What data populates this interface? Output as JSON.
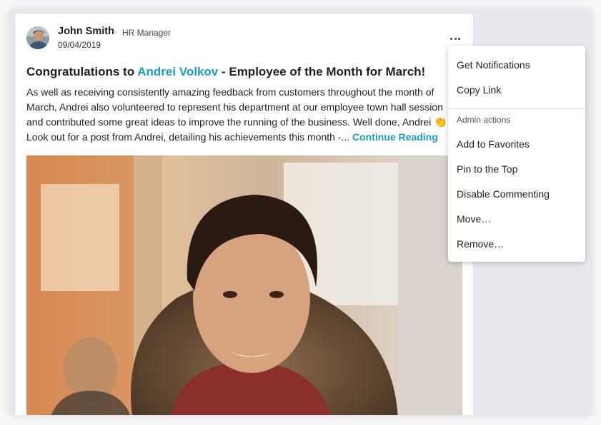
{
  "post": {
    "author": {
      "name": "John Smith",
      "separator": "·",
      "role": "HR Manager",
      "date": "09/04/2019"
    },
    "title": {
      "prefix": "Congratulations to ",
      "mention": "Andrei Volkov",
      "suffix": " - Employee of the Month for March!"
    },
    "body": {
      "text": "As well as receiving consistently amazing feedback from customers throughout the month of March, Andrei also volunteered to represent his department at our employee town hall session and contributed some great ideas to improve the running of the business. Well done, Andrei ",
      "emoji": "👏",
      "text2": " Look out for a post from Andrei, detailing his achievements this month -... ",
      "continue_label": "Continue Reading"
    }
  },
  "menu": {
    "items_top": [
      "Get Notifications",
      "Copy Link"
    ],
    "section_label": "Admin actions",
    "items_admin": [
      "Add to Favorites",
      "Pin to the Top",
      "Disable Commenting",
      "Move…",
      "Remove…"
    ]
  },
  "icons": {
    "more": "more-horizontal-icon"
  },
  "colors": {
    "accent": "#1a9cc4",
    "panel_bg": "#e8e8ee",
    "card_bg": "#ffffff"
  }
}
